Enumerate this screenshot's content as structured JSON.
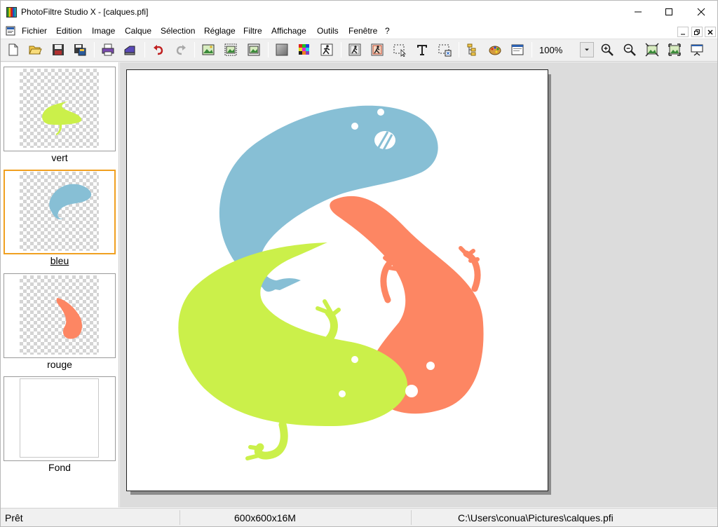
{
  "window": {
    "title": "PhotoFiltre Studio X - [calques.pfi]"
  },
  "menu": {
    "items": [
      "Fichier",
      "Edition",
      "Image",
      "Calque",
      "Sélection",
      "Réglage",
      "Filtre",
      "Affichage",
      "Outils",
      "Fenêtre",
      "?"
    ]
  },
  "toolbar": {
    "icons": [
      "new-file-icon",
      "open-folder-icon",
      "save-icon",
      "save-all-icon",
      "print-icon",
      "scan-icon",
      "undo-icon",
      "redo-icon",
      "image-size-icon",
      "canvas-size-icon",
      "frame-icon",
      "gray-color-icon",
      "palette-icon",
      "automatic-icon",
      "layer-transform-icon",
      "layer-options-icon",
      "selection-icon",
      "text-icon",
      "pattern-selection-icon",
      "layers-manager-icon",
      "plugins-icon",
      "window-icon",
      "zoom-in-icon",
      "zoom-out-icon",
      "fit-image-icon",
      "fit-window-icon",
      "fullscreen-icon"
    ],
    "zoom": "100%"
  },
  "layers": [
    {
      "name": "vert",
      "color": "#cbf04a",
      "selected": false
    },
    {
      "name": "bleu",
      "color": "#87bfd5",
      "selected": true
    },
    {
      "name": "rouge",
      "color": "#fd8663",
      "selected": false
    },
    {
      "name": "Fond",
      "color": "#ffffff",
      "selected": false
    }
  ],
  "colors": {
    "green": "#cbf04a",
    "blue": "#87bfd5",
    "orange": "#fd8663",
    "selection": "#f0a020"
  },
  "status": {
    "state": "Prêt",
    "image_info": "600x600x16M",
    "path": "C:\\Users\\conua\\Pictures\\calques.pfi"
  }
}
